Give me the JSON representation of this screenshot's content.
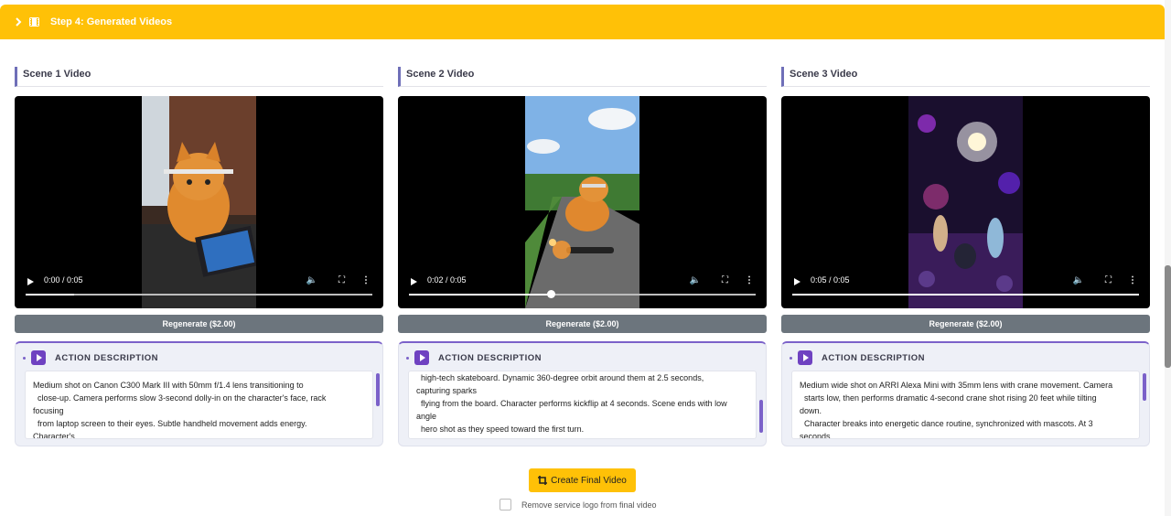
{
  "header": {
    "title": "Step 4: Generated Videos"
  },
  "scenes": [
    {
      "title": "Scene 1 Video",
      "time": "0:00 / 0:05",
      "progress": 0.14,
      "show_knob": false,
      "regenerate_label": "Regenerate ($2.00)",
      "action_title": "ACTION DESCRIPTION",
      "action_text": "Medium shot on Canon C300 Mark III with 50mm f/1.4 lens transitioning to\n  close-up. Camera performs slow 3-second dolly-in on the character's face, rack\nfocusing\n  from laptop screen to their eyes. Subtle handheld movement adds energy.\nCharacter's"
    },
    {
      "title": "Scene 2 Video",
      "time": "0:02 / 0:05",
      "progress": 0.41,
      "show_knob": true,
      "regenerate_label": "Regenerate ($2.00)",
      "action_title": "ACTION DESCRIPTION",
      "action_text": "  high-tech skateboard. Dynamic 360-degree orbit around them at 2.5 seconds,\ncapturing sparks\n  flying from the board. Character performs kickflip at 4 seconds. Scene ends with low\nangle\n  hero shot as they speed toward the first turn."
    },
    {
      "title": "Scene 3 Video",
      "time": "0:05 / 0:05",
      "progress": 1.0,
      "show_knob": false,
      "regenerate_label": "Regenerate ($2.00)",
      "action_title": "ACTION DESCRIPTION",
      "action_text": "Medium wide shot on ARRI Alexa Mini with 35mm lens with crane movement. Camera\n  starts low, then performs dramatic 4-second crane shot rising 20 feet while tilting\ndown.\n  Character breaks into energetic dance routine, synchronized with mascots. At 3\nseconds"
    }
  ],
  "final_button": {
    "label": "Create Final Video"
  },
  "logo_option": {
    "label": "Remove service logo from final video",
    "checked": false
  },
  "colors": {
    "accent": "#ffc107",
    "purple": "#6f42c1",
    "regen": "#6c757d"
  }
}
